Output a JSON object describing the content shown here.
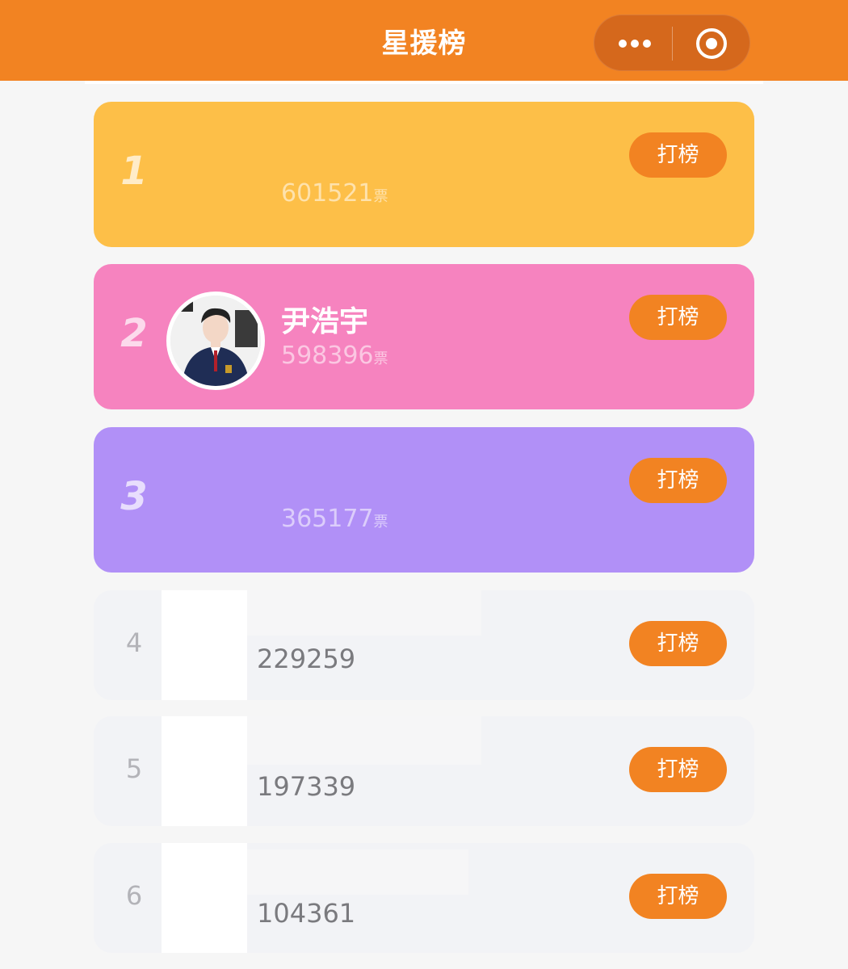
{
  "header": {
    "title": "星援榜"
  },
  "capsule": {
    "more_icon": "more-dots-icon",
    "close_icon": "target-circle-icon"
  },
  "colors": {
    "brand_orange": "#f28322",
    "rank1_bg": "#fdbf48",
    "rank2_bg": "#f683bf",
    "rank3_bg": "#b190f7",
    "plain_bg": "#f2f3f6"
  },
  "ranking": [
    {
      "rank": "1",
      "name": "",
      "votes": "601521",
      "unit": "票",
      "button": "打榜"
    },
    {
      "rank": "2",
      "name": "尹浩宇",
      "votes": "598396",
      "unit": "票",
      "button": "打榜"
    },
    {
      "rank": "3",
      "name": "",
      "votes": "365177",
      "unit": "票",
      "button": "打榜"
    },
    {
      "rank": "4",
      "name": "",
      "votes": "229259",
      "button": "打榜"
    },
    {
      "rank": "5",
      "name": "",
      "votes": "197339",
      "button": "打榜"
    },
    {
      "rank": "6",
      "name": "",
      "votes": "104361",
      "button": "打榜"
    }
  ]
}
